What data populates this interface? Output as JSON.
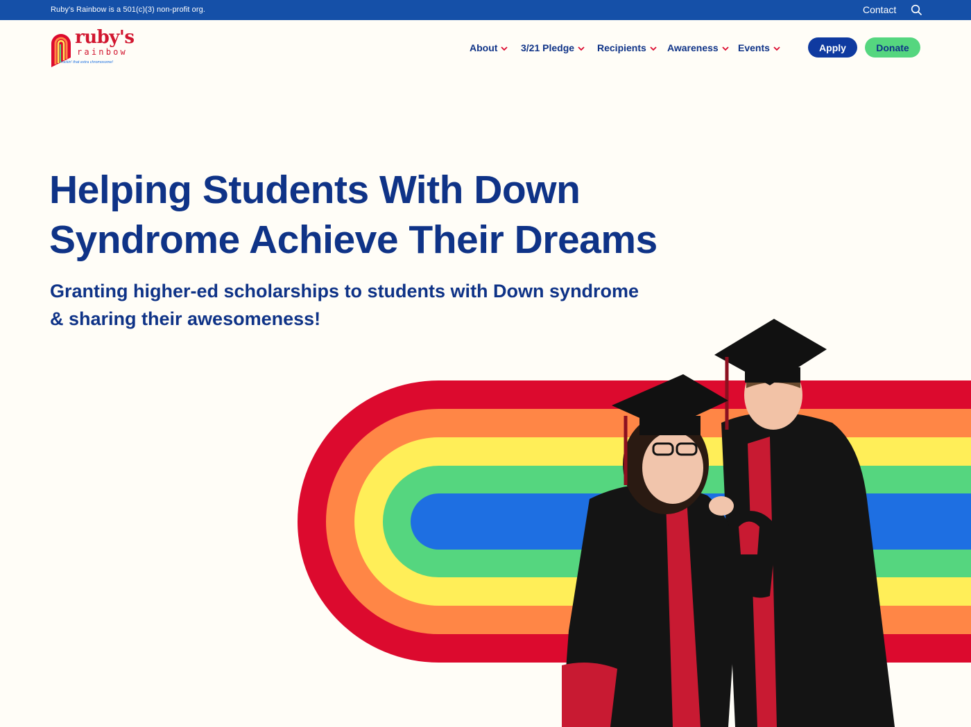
{
  "topbar": {
    "org_text": "Ruby's Rainbow is a 501(c)(3) non-profit org.",
    "contact": "Contact",
    "search_icon": "search-icon"
  },
  "logo": {
    "word1": "ruby's",
    "word2": "rainbow",
    "tagline": "rockin' that extra chromosome!"
  },
  "nav": {
    "items": [
      {
        "label": "About"
      },
      {
        "label": "3/21 Pledge"
      },
      {
        "label": "Recipients"
      },
      {
        "label": "Awareness"
      },
      {
        "label": "Events"
      }
    ],
    "apply": "Apply",
    "donate": "Donate"
  },
  "hero": {
    "headline_line1": "Helping Students With Down",
    "headline_line2": "Syndrome Achieve Their Dreams",
    "sub_line1": "Granting higher-ed scholarships to students with Down syndrome",
    "sub_line2": "& sharing their awesomeness!"
  },
  "colors": {
    "brand_blue": "#0f3387",
    "bar_blue": "#1550a8",
    "donate_green": "#55d67f",
    "rainbow": [
      "#dc0a2e",
      "#ff8646",
      "#ffee58",
      "#55d67f",
      "#1e6fe2"
    ]
  }
}
